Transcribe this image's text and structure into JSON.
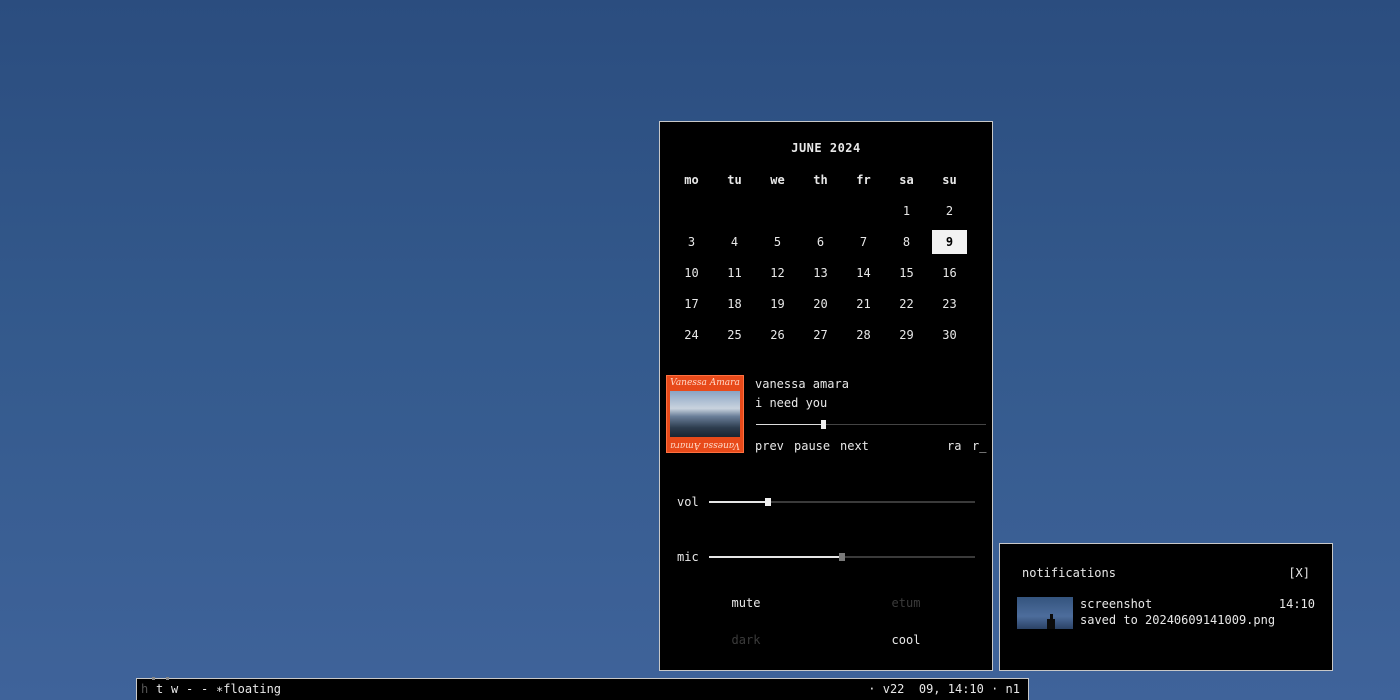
{
  "calendar": {
    "title": "JUNE 2024",
    "weekdays": [
      "mo",
      "tu",
      "we",
      "th",
      "fr",
      "sa",
      "su"
    ],
    "weeks": [
      [
        "",
        "",
        "",
        "",
        "",
        "1",
        "2"
      ],
      [
        "3",
        "4",
        "5",
        "6",
        "7",
        "8",
        "9"
      ],
      [
        "10",
        "11",
        "12",
        "13",
        "14",
        "15",
        "16"
      ],
      [
        "17",
        "18",
        "19",
        "20",
        "21",
        "22",
        "23"
      ],
      [
        "24",
        "25",
        "26",
        "27",
        "28",
        "29",
        "30"
      ]
    ],
    "today": "9"
  },
  "media": {
    "album_art_text": "Vanessa Amara",
    "album_art_text_bottom": "Vanessa Amara",
    "artist": "vanessa amara",
    "title": "i need you",
    "progress_fraction": 0.29,
    "buttons": {
      "prev": "prev",
      "pause": "pause",
      "next": "next",
      "ra": "ra",
      "r": "r_"
    }
  },
  "sliders": {
    "vol": {
      "label": "vol",
      "level": 0.22
    },
    "mic": {
      "label": "mic",
      "level": 0.5
    }
  },
  "toggles": {
    "mute": "mute",
    "etum": "etum",
    "dark": "dark",
    "cool": "cool"
  },
  "notifications": {
    "title": "notifications",
    "close": "[X]",
    "items": [
      {
        "app": "screenshot",
        "time": "14:10",
        "body": "saved to 20240609141009.png"
      }
    ]
  },
  "bar": {
    "workspaces": [
      "h",
      "t",
      "w",
      "-",
      "-"
    ],
    "layout_symbol": "∗",
    "layout": "floating",
    "status": "· v22  09, 14:10 · n1"
  },
  "colors": {
    "desktop": "#345a8d",
    "panel": "#000000",
    "border": "#c8c8c8",
    "text": "#e8e8e8",
    "disabled": "#3b3b3b"
  }
}
